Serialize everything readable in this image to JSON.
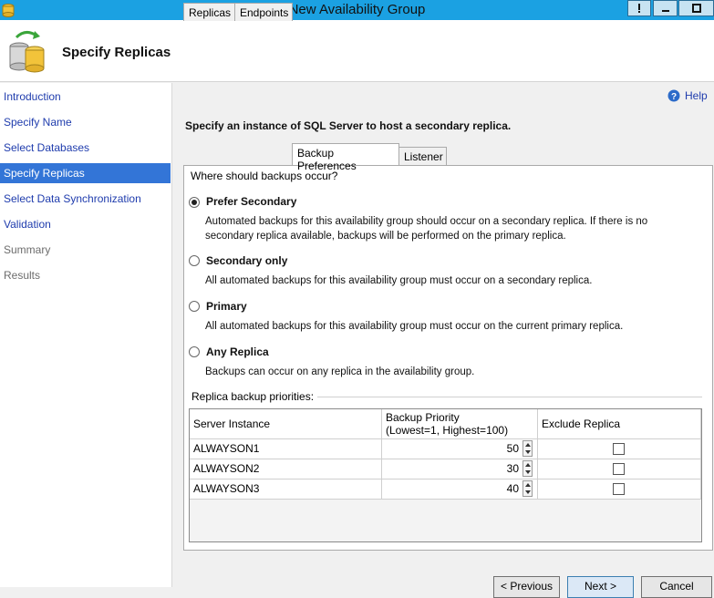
{
  "window": {
    "title": "New Availability Group"
  },
  "header": {
    "title": "Specify Replicas"
  },
  "nav": {
    "items": [
      {
        "label": "Introduction",
        "state": "link"
      },
      {
        "label": "Specify Name",
        "state": "link"
      },
      {
        "label": "Select Databases",
        "state": "link"
      },
      {
        "label": "Specify Replicas",
        "state": "active"
      },
      {
        "label": "Select Data Synchronization",
        "state": "link"
      },
      {
        "label": "Validation",
        "state": "link"
      },
      {
        "label": "Summary",
        "state": "disabled"
      },
      {
        "label": "Results",
        "state": "disabled"
      }
    ]
  },
  "help": {
    "label": "Help"
  },
  "main": {
    "instruction": "Specify an instance of SQL Server to host a secondary replica.",
    "tabs": [
      {
        "label": "Replicas"
      },
      {
        "label": "Endpoints"
      },
      {
        "label": "Backup Preferences",
        "active": true
      },
      {
        "label": "Listener"
      }
    ]
  },
  "backup": {
    "question": "Where should backups occur?",
    "options": [
      {
        "label": "Prefer Secondary",
        "checked": true,
        "desc1": "Automated backups for this availability group should occur on a secondary replica. If there is no",
        "desc2": "secondary replica available, backups will be performed on the primary replica."
      },
      {
        "label": "Secondary only",
        "checked": false,
        "desc1": "All automated backups for this availability group must occur on a secondary replica."
      },
      {
        "label": "Primary",
        "checked": false,
        "desc1": "All automated backups for this availability group must occur on the current primary replica."
      },
      {
        "label": "Any Replica",
        "checked": false,
        "desc1": "Backups can occur on any replica in the availability group."
      }
    ],
    "priorities_label": "Replica backup priorities:",
    "table": {
      "headers": {
        "server": "Server Instance",
        "priority_line1": "Backup Priority",
        "priority_line2": "(Lowest=1, Highest=100)",
        "exclude": "Exclude Replica"
      },
      "rows": [
        {
          "server": "ALWAYSON1",
          "priority": "50",
          "exclude": false
        },
        {
          "server": "ALWAYSON2",
          "priority": "30",
          "exclude": false
        },
        {
          "server": "ALWAYSON3",
          "priority": "40",
          "exclude": false
        }
      ]
    }
  },
  "footer": {
    "previous": "< Previous",
    "next": "Next >",
    "cancel": "Cancel"
  },
  "colors": {
    "titlebar": "#1ba1e2",
    "nav_active": "#3375d7",
    "link": "#1f3cad"
  }
}
